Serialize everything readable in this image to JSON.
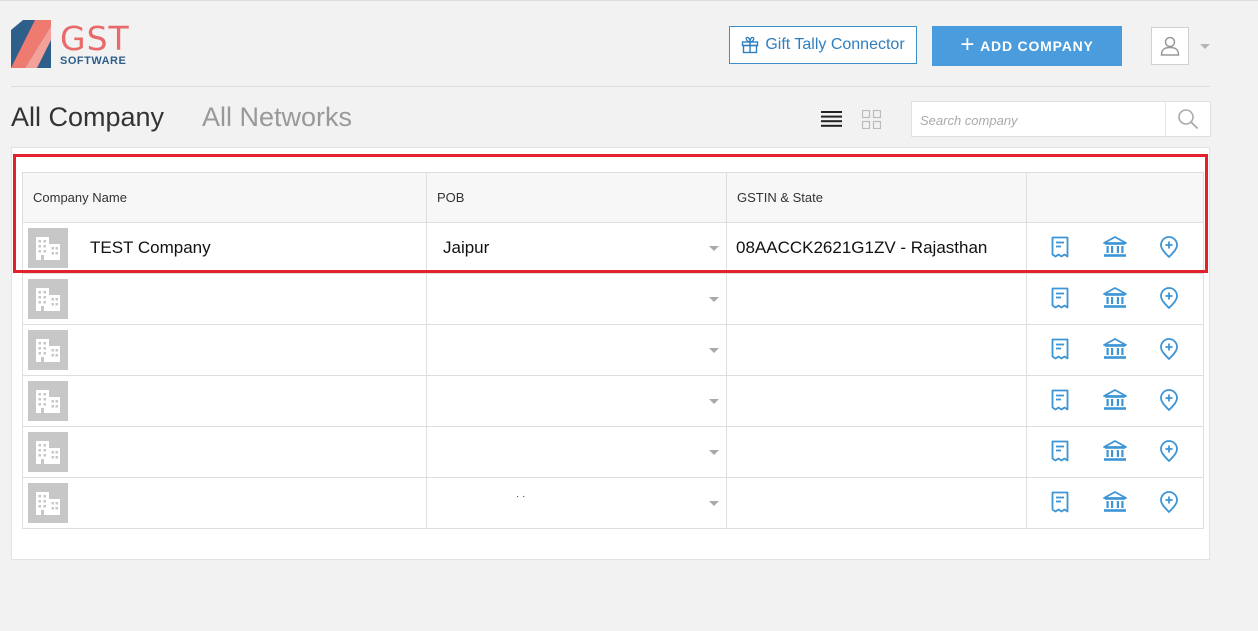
{
  "brand": {
    "name": "GST",
    "sub": "SOFTWARE",
    "color": "#e86a6a",
    "sub_color": "#2d5f8a"
  },
  "header": {
    "gift_label": "Gift Tally Connector",
    "add_label": "ADD COMPANY",
    "accent": "#4a9cdc"
  },
  "tabs": {
    "all_company": "All Company",
    "all_networks": "All Networks"
  },
  "search": {
    "placeholder": "Search company",
    "value": ""
  },
  "table": {
    "headers": [
      "Company Name",
      "POB",
      "GSTIN & State",
      ""
    ],
    "rows": [
      {
        "name": "TEST Company",
        "pob": "Jaipur",
        "gstin": "08AACCK2621G1ZV - Rajasthan"
      },
      {
        "name": "",
        "pob": "",
        "gstin": ""
      },
      {
        "name": "",
        "pob": "",
        "gstin": ""
      },
      {
        "name": "",
        "pob": "",
        "gstin": ""
      },
      {
        "name": "",
        "pob": "",
        "gstin": ""
      },
      {
        "name": "",
        "pob": "",
        "gstin": ""
      }
    ]
  },
  "icons": {
    "row_actions": [
      "receipt-icon",
      "bank-icon",
      "add-location-icon"
    ],
    "building": "building-icon",
    "user": "user-icon"
  },
  "highlight_color": "#e3212d"
}
